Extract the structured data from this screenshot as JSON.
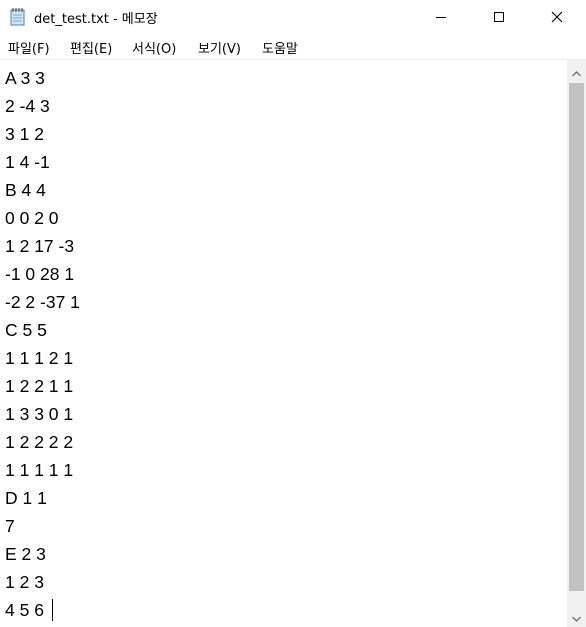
{
  "window": {
    "title": "det_test.txt - 메모장",
    "icon": "notepad-icon",
    "controls": {
      "minimize_icon": "minimize-icon",
      "maximize_icon": "maximize-icon",
      "close_icon": "close-icon"
    }
  },
  "menu": {
    "file": "파일(F)",
    "edit": "편집(E)",
    "format": "서식(O)",
    "view": "보기(V)",
    "help": "도움말"
  },
  "editor": {
    "lines": [
      "A 3 3",
      "2 -4 3",
      "3 1 2",
      "1 4 -1",
      "B 4 4",
      "0 0 2 0",
      "1 2 17 -3",
      "-1 0 28 1",
      "-2 2 -37 1",
      "C 5 5",
      "1 1 1 2 1",
      "1 2 2 1 1",
      "1 3 3 0 1",
      "1 2 2 2 2",
      "1 1 1 1 1",
      "D 1 1",
      "7",
      "E 2 3",
      "1 2 3",
      "4 5 6"
    ]
  },
  "scrollbar": {
    "up_icon": "scroll-up-arrow-icon",
    "down_icon": "scroll-down-arrow-icon"
  },
  "colors": {
    "background": "#ffffff",
    "scroll_track": "#f0f0f0",
    "scroll_thumb": "#c2c2c2",
    "text": "#000000"
  }
}
